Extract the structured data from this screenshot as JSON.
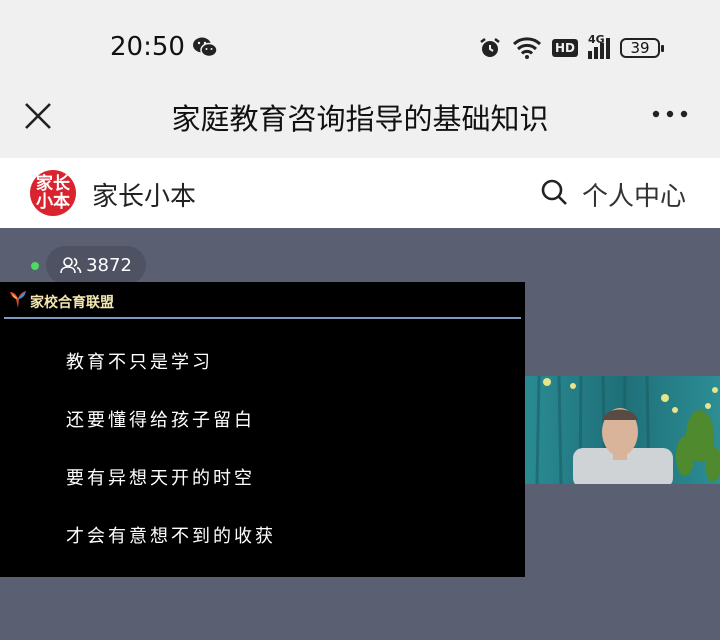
{
  "status_bar": {
    "time": "20:50",
    "network_label": "4G",
    "hd_label": "HD",
    "battery": "39",
    "icons": [
      "wechat-icon",
      "alarm-icon",
      "wifi-icon",
      "hd-icon",
      "signal-icon",
      "battery-icon"
    ]
  },
  "title_bar": {
    "title": "家庭教育咨询指导的基础知识",
    "close_icon": "close-icon",
    "more_icon": "more-icon"
  },
  "channel": {
    "logo_text_1": "家长",
    "logo_text_2": "小本",
    "name": "家长小本",
    "search_icon": "search-icon",
    "personal_center": "个人中心",
    "brand_color": "#d9232e"
  },
  "live": {
    "viewer_count": "3872",
    "live_indicator_color": "#4cd964",
    "slide": {
      "brand": "家校合育联盟",
      "lines": [
        "教育不只是学习",
        "还要懂得给孩子留白",
        "要有异想天开的时空",
        "才会有意想不到的收获"
      ]
    }
  }
}
